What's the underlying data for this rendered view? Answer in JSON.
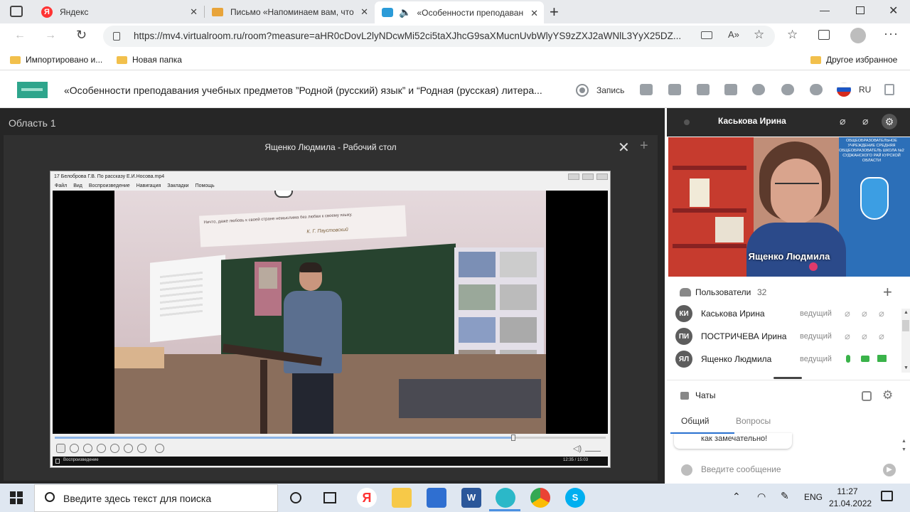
{
  "browser": {
    "tabs": [
      {
        "label": "Яндекс"
      },
      {
        "label": "Письмо «Напоминаем вам, что"
      },
      {
        "label": "«Особенности преподаван"
      }
    ],
    "url": "https://mv4.virtualroom.ru/room?measure=aHR0cDovL2lyNDcwMi52ci5taXJhcG9saXMucnUvbWlyYS9zZXJ2aWNlL3YyX25DZ...",
    "bookmarks": [
      "Импортировано и...",
      "Новая папка"
    ],
    "other_favorites": "Другое избранное"
  },
  "header": {
    "title": "«Особенности преподавания учебных предметов ”Родной (русский) язык” и “Родная (русская) литера...",
    "record_label": "Запись",
    "lang": "RU"
  },
  "workspace": {
    "area_label": "Область 1",
    "panel_title": "Ященко Людмила - Рабочий стол",
    "player": {
      "window_title": "17 Белоброва Г.В. По рассказу Е.И.Носова.mp4",
      "menu": [
        "Файл",
        "Вид",
        "Воспроизведение",
        "Навигация",
        "Закладки",
        "Помощь"
      ],
      "status_left": "Воспроизведение",
      "time": "12:35 / 15:03",
      "classroom_banner": "Ничто, даже любовь к своей стране немыслима без любви к своему языку.",
      "classroom_author": "К. Г. Паустовский",
      "progress": 0.832
    }
  },
  "video_tile": {
    "host": "Каськова Ирина",
    "speaker": "Ященко Людмила",
    "backdrop_text": "ОБЩЕОБРАЗОВАТЕЛЬНОЕ УЧРЕЖДЕНИЕ СРЕДНЯЯ ОБЩЕОБРАЗОВАТЕЛЬ ШКОЛА №2 СУДЖАНСКОГО РАЙ КУРСКОЙ ОБЛАСТИ"
  },
  "users": {
    "title": "Пользователи",
    "count": "32",
    "list": [
      {
        "initials": "КИ",
        "name": "Каськова Ирина",
        "role": "ведущий",
        "active": false
      },
      {
        "initials": "ПИ",
        "name": "ПОСТРИЧЕВА Ирина",
        "role": "ведущий",
        "active": false
      },
      {
        "initials": "ЯЛ",
        "name": "Ященко Людмила",
        "role": "ведущий",
        "active": true
      }
    ]
  },
  "chat": {
    "title": "Чаты",
    "tabs": [
      "Общий",
      "Вопросы"
    ],
    "last_message": "как замечательно!",
    "placeholder": "Введите сообщение"
  },
  "taskbar": {
    "search_placeholder": "Введите здесь текст для поиска",
    "lang": "ENG",
    "time": "11:27",
    "date": "21.04.2022"
  },
  "colors": {
    "accent": "#2b74d5",
    "online_green": "#3ab34a",
    "record_red": "#e53935"
  }
}
